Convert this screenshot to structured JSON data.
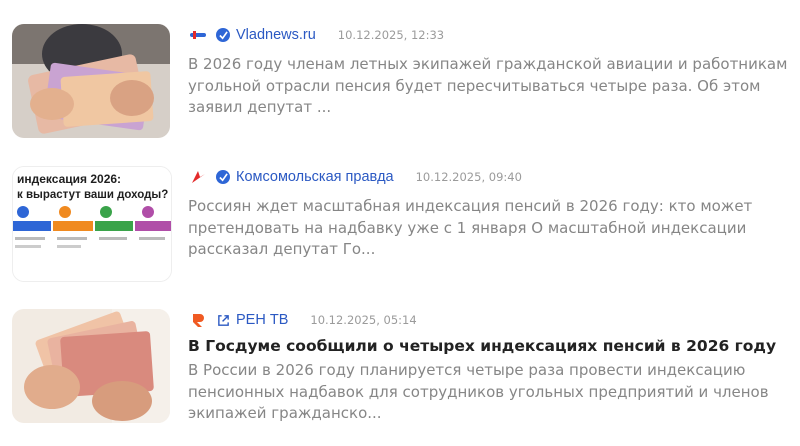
{
  "items": [
    {
      "source": "Vladnews.ru",
      "time": "10.12.2025, 12:33",
      "title": "",
      "snippet": "В 2026 году членам летных экипажей гражданской авиации и работникам угольной отрасли пенсия будет пересчитываться четыре раза. Об этом заявил депутат ...",
      "logo_icon": "vladnews-logo-icon",
      "badge_icon": "verified-icon"
    },
    {
      "source": "Комсомольская правда",
      "time": "10.12.2025, 09:40",
      "title": "",
      "snippet": "Россиян ждет масштабная индексация пенсий в 2026 году: кто может претендовать на надбавку уже с 1 января О масштабной индексации рассказал депутат Го...",
      "logo_icon": "kp-logo-icon",
      "badge_icon": "verified-icon",
      "thumb_text": "индексация 2026:\nк вырастут ваши доходы?"
    },
    {
      "source": "РЕН ТВ",
      "time": "10.12.2025, 05:14",
      "title": "В Госдуме сообщили о четырех индексациях пенсий в 2026 году",
      "snippet": "В России в 2026 году планируется четыре раза провести индексацию пенсионных надбавок для сотрудников угольных предприятий и членов экипажей гражданско...",
      "logo_icon": "rentv-logo-icon",
      "badge_icon": "external-link-icon"
    }
  ],
  "colors": {
    "source_link": "#2b59c3",
    "verified": "#2e66d6",
    "rentv": "#f05a22",
    "kp": "#e32b2b"
  }
}
